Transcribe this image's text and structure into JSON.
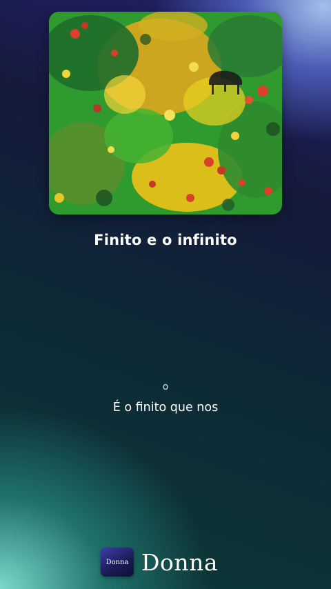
{
  "song": {
    "title": "Finito e o infinito"
  },
  "lyrics": {
    "previous_line": "o",
    "current_line": "É o finito que nos"
  },
  "brand": {
    "icon_label": "Donna",
    "name": "Donna"
  },
  "colors": {
    "text": "#ffffff",
    "accent_green": "#2fa52a",
    "accent_yellow": "#f2c215",
    "accent_red": "#d9412a"
  }
}
